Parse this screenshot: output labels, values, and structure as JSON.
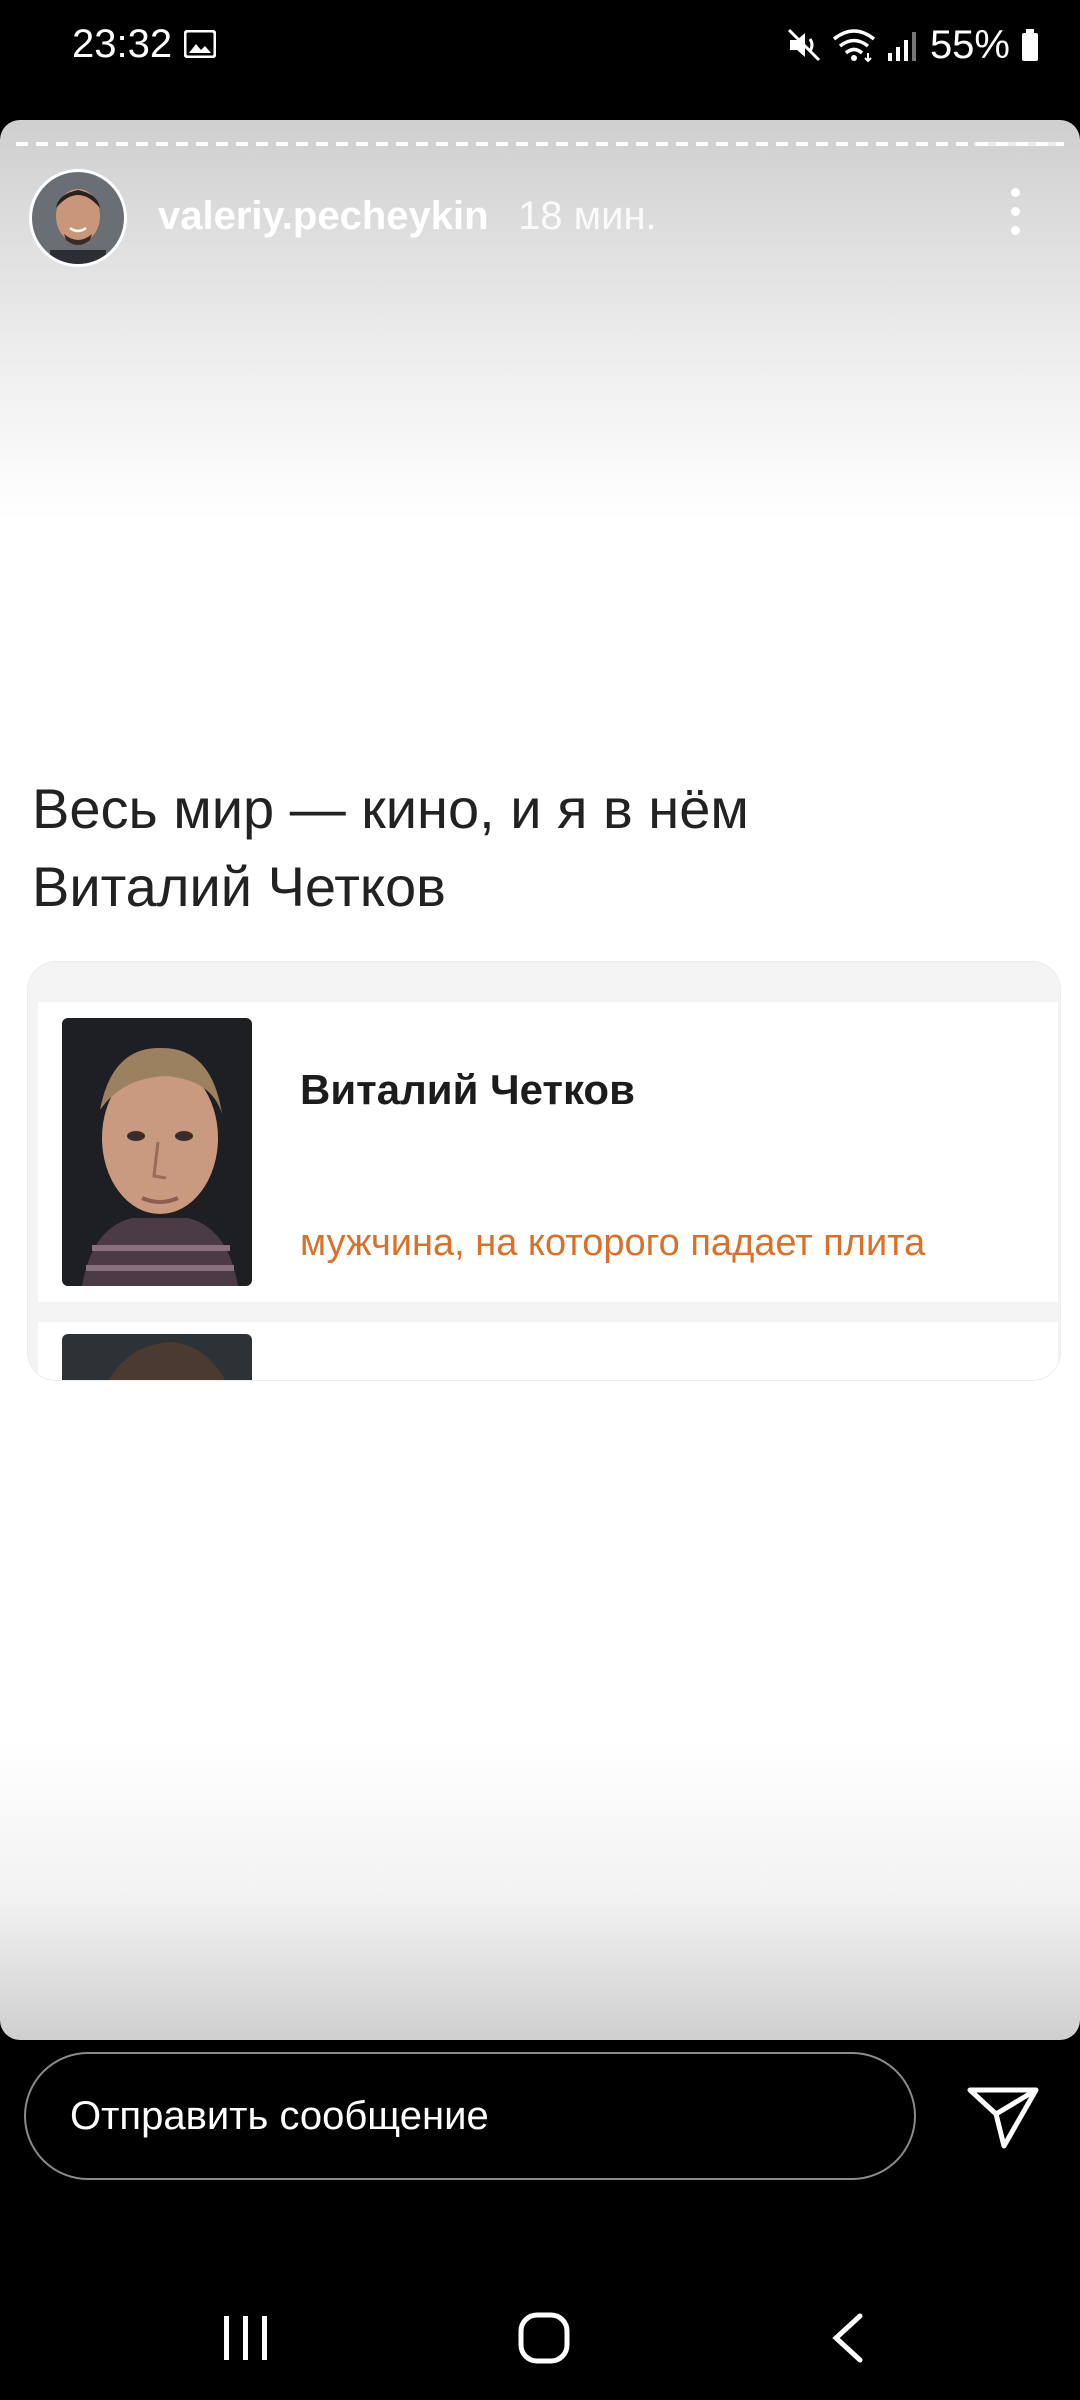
{
  "status_bar": {
    "time": "23:32",
    "battery_percent": "55%",
    "icons": [
      "gallery-icon",
      "mute-icon",
      "wifi-icon",
      "signal-icon",
      "battery-icon"
    ]
  },
  "story": {
    "username": "valeriy.pecheykin",
    "time_ago": "18 мин.",
    "headline_line1": "Весь мир — кино, и я в нём",
    "headline_line2": "Виталий Четков",
    "card": {
      "name": "Виталий Четков",
      "role": "мужчина, на которого падает плита"
    }
  },
  "message_bar": {
    "placeholder": "Отправить сообщение"
  },
  "colors": {
    "role_text": "#d9712a",
    "background": "#000000"
  }
}
